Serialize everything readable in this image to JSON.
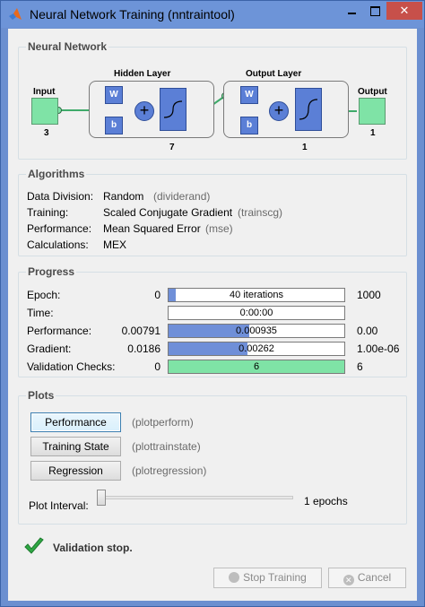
{
  "window": {
    "title": "Neural Network Training (nntraintool)",
    "close_glyph": "✕"
  },
  "neural_network": {
    "label": "Neural Network",
    "input": {
      "label": "Input",
      "size": "3"
    },
    "hidden": {
      "label": "Hidden Layer",
      "size": "7",
      "w": "W",
      "b": "b"
    },
    "output_layer": {
      "label": "Output Layer",
      "size": "1",
      "w": "W",
      "b": "b"
    },
    "output": {
      "label": "Output",
      "size": "1"
    },
    "plus": "+"
  },
  "algorithms": {
    "label": "Algorithms",
    "rows": [
      {
        "key": "Data Division:",
        "value": "Random",
        "fn": "(dividerand)"
      },
      {
        "key": "Training:",
        "value": "Scaled Conjugate Gradient",
        "fn": "(trainscg)"
      },
      {
        "key": "Performance:",
        "value": "Mean Squared Error",
        "fn": "(mse)"
      },
      {
        "key": "Calculations:",
        "value": "MEX",
        "fn": ""
      }
    ]
  },
  "progress": {
    "label": "Progress",
    "rows": [
      {
        "key": "Epoch:",
        "start": "0",
        "bar_text": "40 iterations",
        "end": "1000",
        "fill": 0.04,
        "color": "blue"
      },
      {
        "key": "Time:",
        "start": "",
        "bar_text": "0:00:00",
        "end": "",
        "fill": 0.0,
        "color": "blue"
      },
      {
        "key": "Performance:",
        "start": "0.00791",
        "bar_text": "0.000935",
        "end": "0.00",
        "fill": 0.46,
        "color": "blue"
      },
      {
        "key": "Gradient:",
        "start": "0.0186",
        "bar_text": "0.00262",
        "end": "1.00e-06",
        "fill": 0.45,
        "color": "blue"
      },
      {
        "key": "Validation Checks:",
        "start": "0",
        "bar_text": "6",
        "end": "6",
        "fill": 1.0,
        "color": "green"
      }
    ]
  },
  "plots": {
    "label": "Plots",
    "buttons": [
      {
        "label": "Performance",
        "fn": "(plotperform)"
      },
      {
        "label": "Training State",
        "fn": "(plottrainstate)"
      },
      {
        "label": "Regression",
        "fn": "(plotregression)"
      }
    ],
    "interval_label": "Plot Interval:",
    "interval_value": "1 epochs"
  },
  "status": {
    "text": "Validation stop."
  },
  "footer": {
    "stop_label": "Stop Training",
    "cancel_label": "Cancel"
  },
  "colors": {
    "green_block": "#7fe3a6",
    "blue_block": "#5b7fd6",
    "bar_blue": "#6f8fd8",
    "check_green": "#2fa844"
  }
}
